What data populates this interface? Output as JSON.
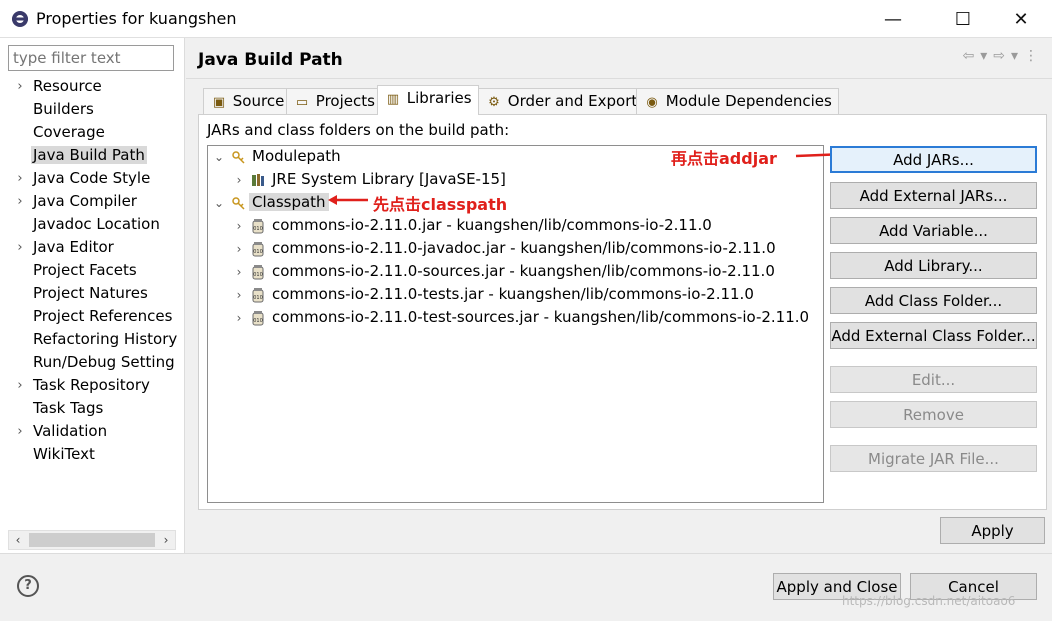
{
  "window": {
    "title": "Properties for kuangshen",
    "minimize": "—",
    "maximize": "☐",
    "close": "✕"
  },
  "filter": {
    "placeholder": "type filter text"
  },
  "nav": [
    {
      "label": "Resource",
      "expandable": true
    },
    {
      "label": "Builders",
      "expandable": false
    },
    {
      "label": "Coverage",
      "expandable": false
    },
    {
      "label": "Java Build Path",
      "expandable": false,
      "selected": true
    },
    {
      "label": "Java Code Style",
      "expandable": true
    },
    {
      "label": "Java Compiler",
      "expandable": true
    },
    {
      "label": "Javadoc Location",
      "expandable": false
    },
    {
      "label": "Java Editor",
      "expandable": true
    },
    {
      "label": "Project Facets",
      "expandable": false
    },
    {
      "label": "Project Natures",
      "expandable": false
    },
    {
      "label": "Project References",
      "expandable": false
    },
    {
      "label": "Refactoring History",
      "expandable": false
    },
    {
      "label": "Run/Debug Setting",
      "expandable": false
    },
    {
      "label": "Task Repository",
      "expandable": true
    },
    {
      "label": "Task Tags",
      "expandable": false
    },
    {
      "label": "Validation",
      "expandable": true
    },
    {
      "label": "WikiText",
      "expandable": false
    }
  ],
  "page": {
    "title": "Java Build Path"
  },
  "tabs": [
    "Source",
    "Projects",
    "Libraries",
    "Order and Export",
    "Module Dependencies"
  ],
  "libraries": {
    "caption": "JARs and class folders on the build path:",
    "tree": {
      "modulepath": "Modulepath",
      "jre": "JRE System Library [JavaSE-15]",
      "classpath": "Classpath",
      "jars": [
        "commons-io-2.11.0.jar - kuangshen/lib/commons-io-2.11.0",
        "commons-io-2.11.0-javadoc.jar - kuangshen/lib/commons-io-2.11.0",
        "commons-io-2.11.0-sources.jar - kuangshen/lib/commons-io-2.11.0",
        "commons-io-2.11.0-tests.jar - kuangshen/lib/commons-io-2.11.0",
        "commons-io-2.11.0-test-sources.jar - kuangshen/lib/commons-io-2.11.0"
      ]
    },
    "annotations": {
      "classpath": "先点击classpath",
      "addjar": "再点击addjar"
    },
    "buttons": {
      "add_jars": "Add JARs...",
      "add_external_jars": "Add External JARs...",
      "add_variable": "Add Variable...",
      "add_library": "Add Library...",
      "add_class_folder": "Add Class Folder...",
      "add_external_class_folder": "Add External Class Folder...",
      "edit": "Edit...",
      "remove": "Remove",
      "migrate_jar": "Migrate JAR File..."
    }
  },
  "apply": "Apply",
  "footer": {
    "help": "?",
    "apply_close": "Apply and Close",
    "cancel": "Cancel"
  },
  "watermark": "https://blog.csdn.net/aitoao6",
  "colors": {
    "annotation": "#e0201b",
    "focus": "#2b7bd6"
  }
}
